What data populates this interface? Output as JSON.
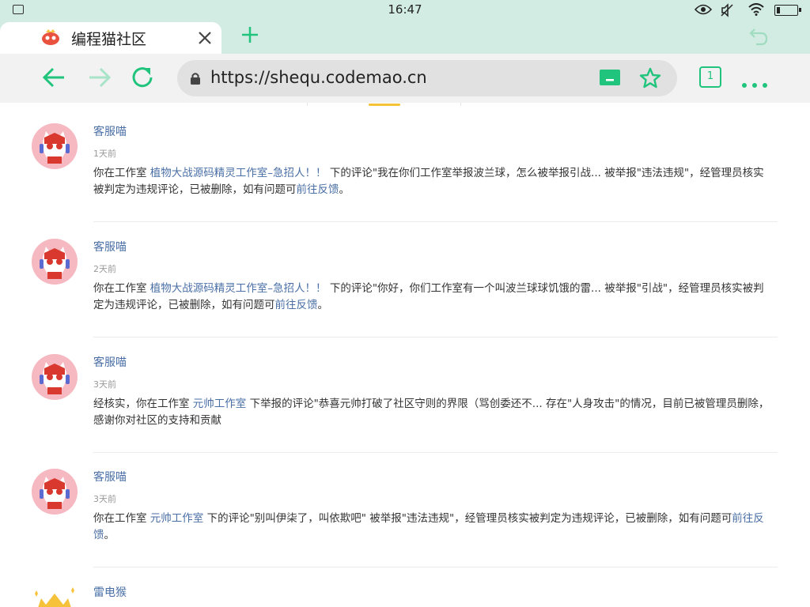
{
  "status_bar": {
    "time": "16:47",
    "battery_level": 0.18
  },
  "tab": {
    "title": "编程猫社区",
    "close_icon": "close-icon",
    "new_tab_icon": "plus-icon",
    "undo_icon": "undo-icon"
  },
  "toolbar": {
    "back_icon": "arrow-left-icon",
    "forward_icon": "arrow-right-icon",
    "reload_icon": "reload-icon",
    "url": "https://shequ.codemao.cn",
    "tab_count": "1",
    "accent": "#20c47c"
  },
  "messages": [
    {
      "sender": "客服喵",
      "time": "1天前",
      "pre": "你在工作室",
      "link": "植物大战源码精灵工作室–急招人！！",
      "mid": "下的评论\"我在你们工作室举报波兰球，怎么被举报引战...  被举报\"违法违规\"，经管理员核实被判定为违规评论，已被删除，如有问题可",
      "tail_link": "前往反馈",
      "end": "。"
    },
    {
      "sender": "客服喵",
      "time": "2天前",
      "pre": "你在工作室",
      "link": "植物大战源码精灵工作室–急招人！！",
      "mid": "下的评论\"你好，你们工作室有一个叫波兰球球饥饿的雷...  被举报\"引战\"，经管理员核实被判定为违规评论，已被删除，如有问题可",
      "tail_link": "前往反馈",
      "end": "。"
    },
    {
      "sender": "客服喵",
      "time": "3天前",
      "pre": "经核实，你在工作室",
      "link": "元帅工作室",
      "mid": "下举报的评论\"恭喜元帅打破了社区守则的界限（骂创委还不...  存在\"人身攻击\"的情况，目前已被管理员删除，感谢你对社区的支持和贡献",
      "tail_link": "",
      "end": ""
    },
    {
      "sender": "客服喵",
      "time": "3天前",
      "pre": "你在工作室",
      "link": "元帅工作室",
      "mid": "下的评论\"别叫伊柒了，叫依欺吧\" 被举报\"违法违规\"，经管理员核实被判定为违规评论，已被删除，如有问题可",
      "tail_link": "前往反馈",
      "end": "。"
    },
    {
      "sender": "雷电猴",
      "time": "",
      "pre": "",
      "link": "",
      "mid": "",
      "tail_link": "",
      "end": ""
    }
  ]
}
